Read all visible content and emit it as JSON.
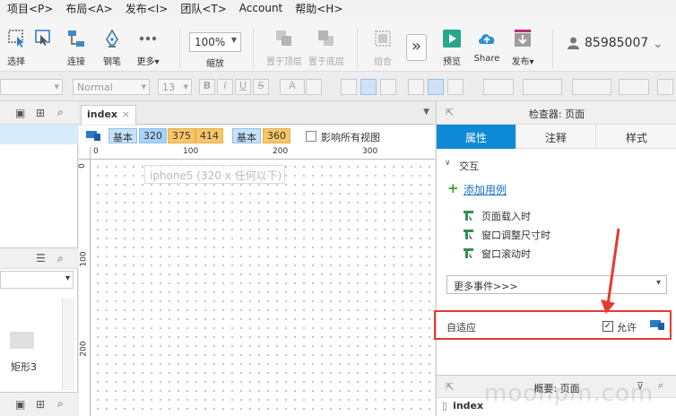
{
  "menu": [
    "项目<P>",
    "布局<A>",
    "发布<I>",
    "团队<T>",
    "Account",
    "帮助<H>"
  ],
  "toolbar": {
    "select": "选择",
    "connect": "连接",
    "pen": "钢笔",
    "more": "更多▾",
    "zoom_value": "100%",
    "zoom_label": "缩放",
    "to_top": "置于顶层",
    "to_bottom": "置于底层",
    "group": "组合",
    "preview": "预览",
    "share": "Share",
    "publish": "发布▾",
    "user_id": "85985007"
  },
  "format": {
    "style": "Normal",
    "size": "13"
  },
  "left": {
    "widget_name": "矩形3"
  },
  "canvas": {
    "tab": "index",
    "breakpoints": {
      "base1": "基本",
      "w320": "320",
      "w375": "375",
      "w414": "414",
      "base2": "基本",
      "w360": "360"
    },
    "affect_all": "影响所有视图",
    "ruler_h": [
      "0",
      "100",
      "200",
      "300"
    ],
    "ruler_v": [
      "0",
      "100",
      "200"
    ],
    "device_label": "iphone5 (320 x 任何以下)"
  },
  "inspector": {
    "title": "检查器: 页面",
    "tabs": [
      "属性",
      "注释",
      "样式"
    ],
    "interactions_title": "交互",
    "add_case": "添加用例",
    "events": [
      "页面载入时",
      "窗口调整尺寸时",
      "窗口滚动时"
    ],
    "more_events": "更多事件>>>",
    "adaptive_label": "自适应",
    "allow_label": "允许",
    "allow_checked": true,
    "overview_title": "概要: 页面",
    "overview_page": "index"
  },
  "watermark": "moonpm.com",
  "colors": {
    "accent_blue": "#0f8ad7",
    "highlight_red": "#e53a32",
    "bp_orange": "#f7c667",
    "bp_blue": "#c6e2f8",
    "add_green": "#2fa02f",
    "event_green": "#2f8f4a"
  }
}
